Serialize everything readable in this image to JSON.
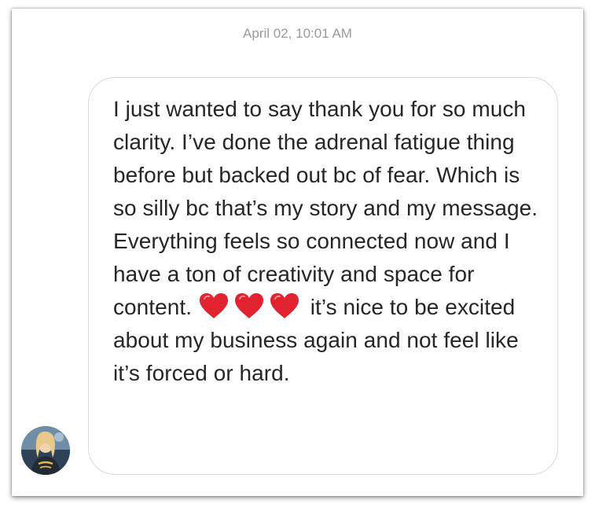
{
  "thread": {
    "timestamp": "April 02, 10:01 AM"
  },
  "message": {
    "text_before_hearts": "I just wanted to say thank you for so much clarity. I’ve done the adrenal fatigue thing before but backed out bc of fear. Which is so silly bc that’s my story and my message. Everything feels so connected now and I have a ton of creativity and space for content.",
    "hearts": [
      "red-heart-emoji",
      "red-heart-emoji",
      "red-heart-emoji"
    ],
    "text_after_hearts": "it’s nice to be excited about my business again and not feel like it’s forced or hard."
  },
  "sender": {
    "avatar_icon": "profile-photo"
  },
  "colors": {
    "bubble_border": "#d9d9d9",
    "text": "#262626",
    "timestamp": "#9a9a9a",
    "heart": "#e0232e"
  }
}
